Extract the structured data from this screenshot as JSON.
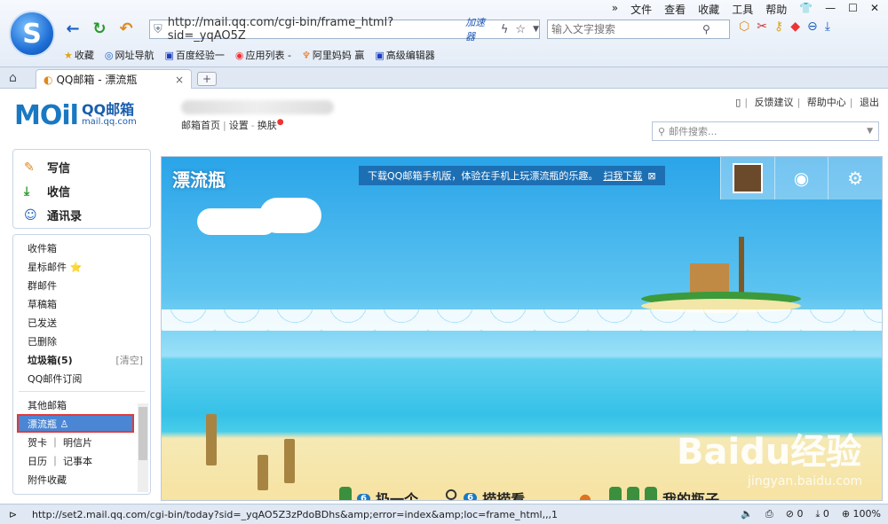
{
  "browser": {
    "menu": [
      "»",
      "文件",
      "查看",
      "收藏",
      "工具",
      "帮助"
    ],
    "address": "http://mail.qq.com/cgi-bin/frame_html?sid=_yqAO5Z",
    "accelerator": "加速器",
    "search_placeholder": "输入文字搜索",
    "bookmarks": [
      {
        "label": "收藏",
        "icon": "star-icon"
      },
      {
        "label": "网址导航",
        "icon": "navigation-icon"
      },
      {
        "label": "百度经验一",
        "icon": "baidu-icon"
      },
      {
        "label": "应用列表 -",
        "icon": "weibo-icon"
      },
      {
        "label": "阿里妈妈 赢",
        "icon": "alimama-icon"
      },
      {
        "label": "高级编辑器",
        "icon": "baidu-icon"
      }
    ],
    "tab_title": "QQ邮箱 - 漂流瓶",
    "new_tab": "+",
    "status_url": "http://set2.mail.qq.com/cgi-bin/today?sid=_yqAO5Z3zPdoBDhs&amp;error=index&amp;loc=frame_html,,,1",
    "status_right": [
      "0",
      "0",
      "100%"
    ]
  },
  "mail": {
    "logo_main": "MOil",
    "logo_cn": "QQ邮箱",
    "logo_domain": "mail.qq.com",
    "head_links": [
      "邮箱首页",
      "设置",
      "换肤"
    ],
    "right_links": [
      "反馈建议",
      "帮助中心",
      "退出"
    ],
    "search_placeholder": "邮件搜索...",
    "compose": [
      "写信",
      "收信",
      "通讯录"
    ],
    "folders": [
      {
        "label": "收件箱"
      },
      {
        "label": "星标邮件 ⭐"
      },
      {
        "label": "群邮件"
      },
      {
        "label": "草稿箱"
      },
      {
        "label": "已发送"
      },
      {
        "label": "已删除"
      },
      {
        "label": "垃圾箱(5)",
        "extra": "[清空]"
      },
      {
        "label": "QQ邮件订阅"
      }
    ],
    "other_folders": [
      {
        "label": "其他邮箱"
      },
      {
        "label": "漂流瓶 ♙"
      },
      {
        "label": "贺卡 ｜ 明信片"
      },
      {
        "label": "日历 ｜ 记事本"
      },
      {
        "label": "附件收藏"
      }
    ]
  },
  "drift": {
    "title": "漂流瓶",
    "notice": "下载QQ邮箱手机版，体验在手机上玩漂流瓶的乐趣。",
    "notice_link": "扫我下载",
    "notice_close": "⊠",
    "actions": [
      {
        "label": "扔一个",
        "badge": "6"
      },
      {
        "label": "捞捞看",
        "badge": "6"
      },
      {
        "label": "我的瓶子",
        "badge": ""
      }
    ],
    "watermark": "Baidu经验",
    "watermark_sub": "jingyan.baidu.com"
  }
}
